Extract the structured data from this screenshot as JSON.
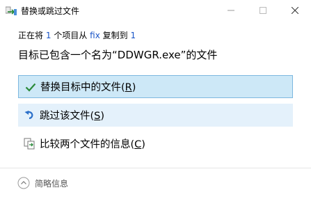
{
  "window": {
    "title": "替换或跳过文件",
    "app_icon": "file-move-icon",
    "controls": {
      "minimize": "minimize-icon",
      "maximize": "maximize-icon",
      "close": "close-icon"
    }
  },
  "status": {
    "prefix": "正在将",
    "count": "1",
    "unit": "个项目从",
    "source": "fix",
    "middle": "复制到",
    "destination": "1"
  },
  "message": "目标已包含一个名为“DDWGR.exe”的文件",
  "options": [
    {
      "label": "替换目标中的文件(",
      "key": "R",
      "end": ")",
      "icon": "checkmark-icon"
    },
    {
      "label": "跳过该文件(",
      "key": "S",
      "end": ")",
      "icon": "skip-arrow-icon"
    },
    {
      "label": "比较两个文件的信息(",
      "key": "C",
      "end": ")",
      "icon": "compare-files-icon"
    }
  ],
  "footer": {
    "details_label": "简略信息",
    "icon": "chevron-up-circle-icon"
  },
  "colors": {
    "link": "#1a55c7",
    "selected_bg": "#cde8f7",
    "selected_border": "#7db8e0",
    "hover_bg": "#e4f1fb",
    "check": "#2a8a3a",
    "skip_arrow": "#2a6fc9"
  }
}
